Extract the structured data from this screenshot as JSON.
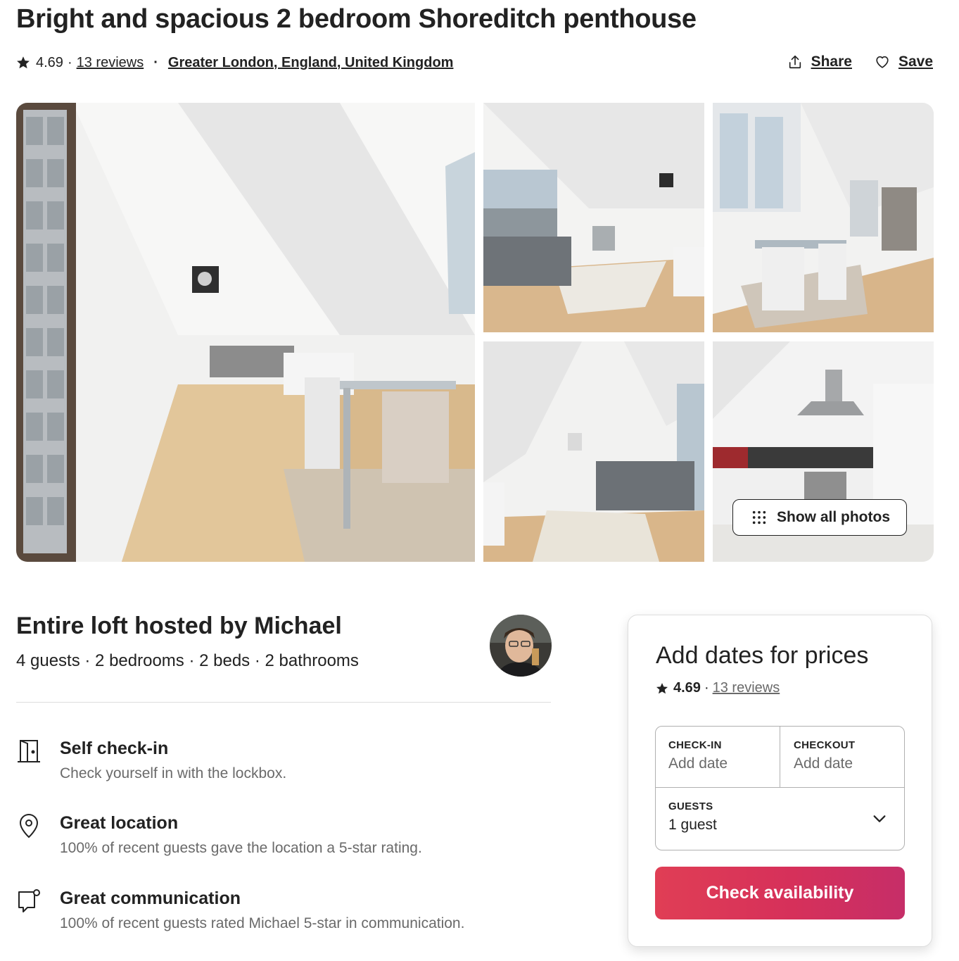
{
  "listing": {
    "title": "Bright and spacious 2 bedroom Shoreditch penthouse",
    "rating": "4.69",
    "reviews_link": "13 reviews",
    "location_link": "Greater London, England, United Kingdom"
  },
  "actions": {
    "share_label": "Share",
    "save_label": "Save"
  },
  "gallery": {
    "show_all_label": "Show all photos"
  },
  "host": {
    "heading": "Entire loft hosted by Michael",
    "details": "4 guests · 2 bedrooms · 2 beds · 2 bathrooms"
  },
  "features": [
    {
      "icon": "door-icon",
      "title": "Self check-in",
      "description": "Check yourself in with the lockbox."
    },
    {
      "icon": "location-pin-icon",
      "title": "Great location",
      "description": "100% of recent guests gave the location a 5-star rating."
    },
    {
      "icon": "chat-bubble-icon",
      "title": "Great communication",
      "description": "100% of recent guests rated Michael 5-star in communication."
    }
  ],
  "booking": {
    "title": "Add dates for prices",
    "rating": "4.69",
    "reviews_link": "13 reviews",
    "checkin_label": "CHECK-IN",
    "checkin_value": "Add date",
    "checkout_label": "CHECKOUT",
    "checkout_value": "Add date",
    "guests_label": "GUESTS",
    "guests_value": "1 guest",
    "cta_label": "Check availability"
  },
  "colors": {
    "text": "#222222",
    "muted": "#6a6a6a",
    "cta_start": "#e03e55",
    "cta_end": "#c62e68",
    "border": "#b0b0b0"
  }
}
